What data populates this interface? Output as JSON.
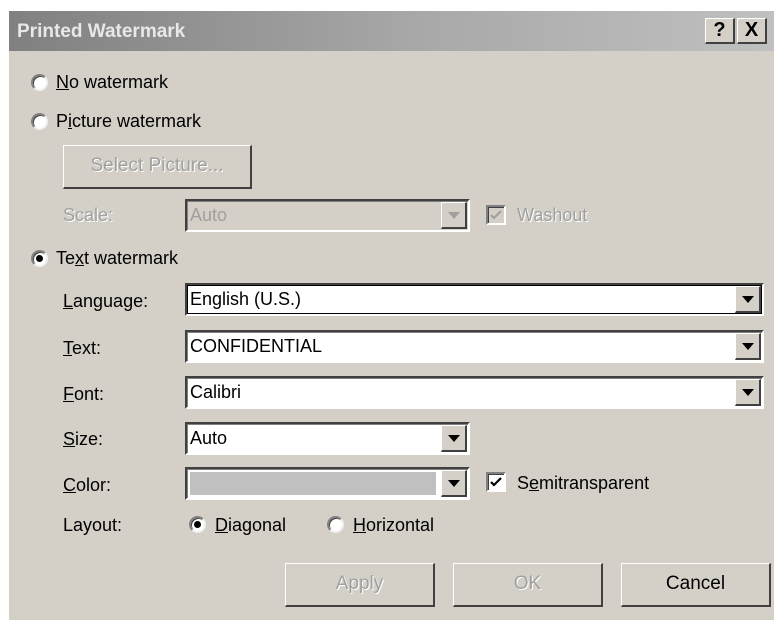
{
  "dialog": {
    "title": "Printed Watermark",
    "help_button": "?",
    "close_button": "X"
  },
  "options": {
    "no_watermark": "No watermark",
    "picture_watermark": "Picture watermark",
    "text_watermark": "Text watermark",
    "selected": "text_watermark"
  },
  "picture": {
    "select_button": "Select Picture...",
    "scale_label": "Scale:",
    "scale_value": "Auto",
    "washout_label": "Washout",
    "washout_checked": true
  },
  "text": {
    "language_label": "Language:",
    "language_value": "English (U.S.)",
    "text_label": "Text:",
    "text_value": "CONFIDENTIAL",
    "font_label": "Font:",
    "font_value": "Calibri",
    "size_label": "Size:",
    "size_value": "Auto",
    "color_label": "Color:",
    "color_value": "#c0c0c0",
    "semitransparent_label": "Semitransparent",
    "semitransparent_checked": true,
    "layout_label": "Layout:",
    "layout_diagonal": "Diagonal",
    "layout_horizontal": "Horizontal",
    "layout_selected": "diagonal"
  },
  "buttons": {
    "apply": "Apply",
    "ok": "OK",
    "cancel": "Cancel"
  }
}
